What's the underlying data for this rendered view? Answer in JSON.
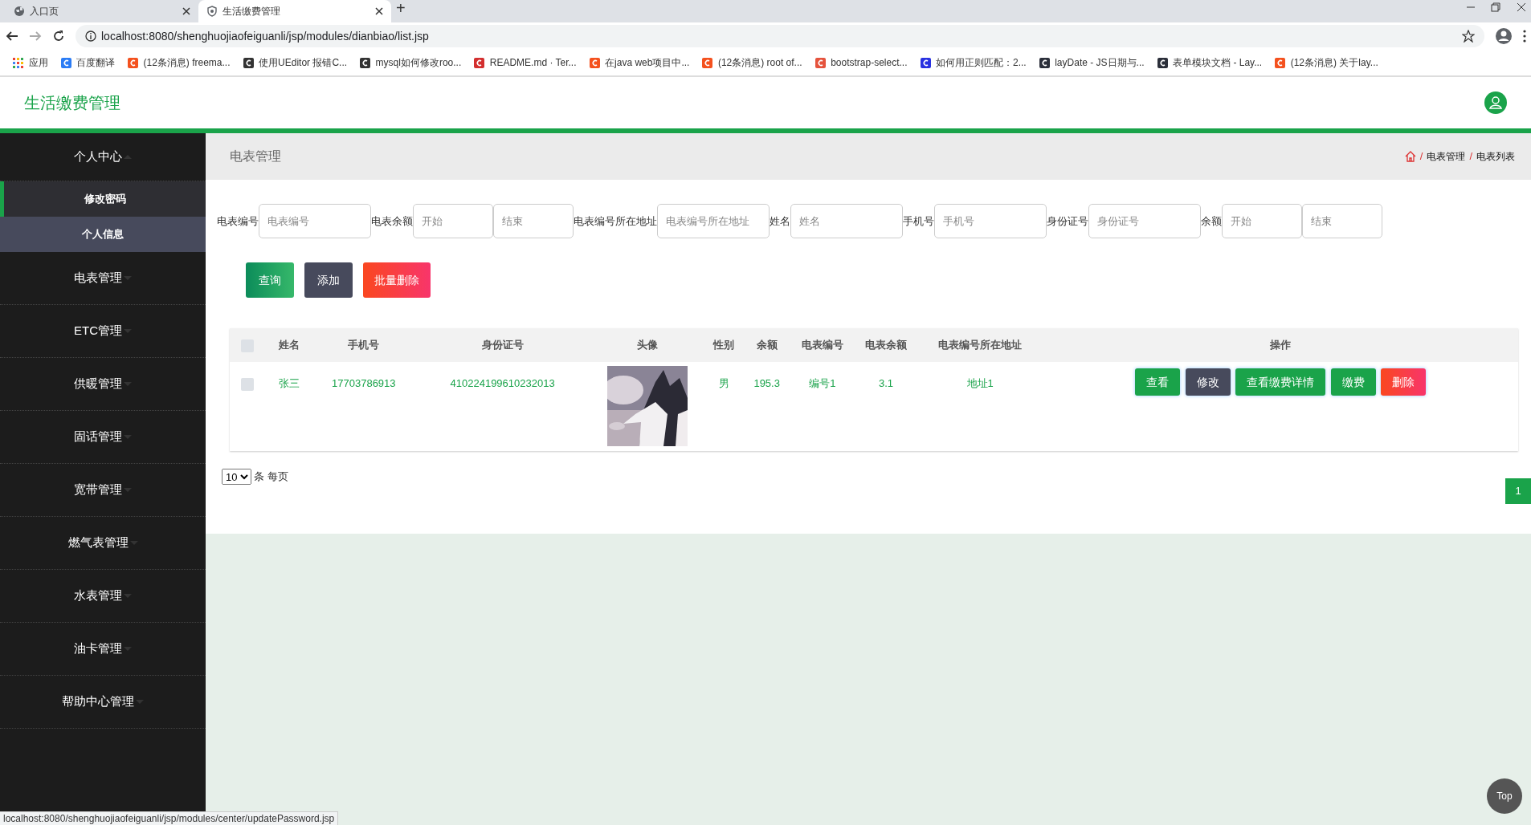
{
  "browser": {
    "tabs": [
      {
        "title": "入口页",
        "selected": false,
        "kind": "globe"
      },
      {
        "title": "生活缴费管理",
        "selected": true,
        "kind": "shield"
      }
    ],
    "new_tab": "+",
    "url": "localhost:8080/shenghuojiaofeiguanli/jsp/modules/dianbiao/list.jsp",
    "bookmarks": [
      {
        "title": "应用"
      },
      {
        "title": "百度翻译",
        "color": "#2b7cf5"
      },
      {
        "title": "(12条消息) freema...",
        "color": "#f4511e"
      },
      {
        "title": "使用UEditor 报错C...",
        "color": "#333333"
      },
      {
        "title": "mysql如何修改roo...",
        "color": "#333333"
      },
      {
        "title": "README.md · Ter...",
        "color": "#d32f2f"
      },
      {
        "title": "在java web项目中...",
        "color": "#f4511e"
      },
      {
        "title": "(12条消息) root of...",
        "color": "#f4511e"
      },
      {
        "title": "bootstrap-select...",
        "color": "#e5533d"
      },
      {
        "title": "如何用正则匹配：2...",
        "color": "#2932e1"
      },
      {
        "title": "layDate - JS日期与...",
        "color": "#2b2f3a"
      },
      {
        "title": "表单模块文档 - Lay...",
        "color": "#2b2f3a"
      },
      {
        "title": "(12条消息) 关于lay...",
        "color": "#f4511e"
      }
    ],
    "status_url": "localhost:8080/shenghuojiaofeiguanli/jsp/modules/center/updatePassword.jsp"
  },
  "app": {
    "title": "生活缴费管理"
  },
  "sidebar": {
    "items": [
      {
        "label": "个人中心",
        "expanded": true,
        "children": [
          {
            "label": "修改密码",
            "selected": true
          },
          {
            "label": "个人信息",
            "selected": false
          }
        ]
      },
      {
        "label": "电表管理",
        "expanded": false
      },
      {
        "label": "ETC管理",
        "expanded": false
      },
      {
        "label": "供暖管理",
        "expanded": false
      },
      {
        "label": "固话管理",
        "expanded": false
      },
      {
        "label": "宽带管理",
        "expanded": false
      },
      {
        "label": "燃气表管理",
        "expanded": false
      },
      {
        "label": "水表管理",
        "expanded": false
      },
      {
        "label": "油卡管理",
        "expanded": false
      },
      {
        "label": "帮助中心管理",
        "expanded": false
      }
    ]
  },
  "page_title": "电表管理",
  "breadcrumb": {
    "separator": "/",
    "items": [
      "电表管理",
      "电表列表"
    ]
  },
  "filters": [
    {
      "label": "电表编号",
      "fields": [
        {
          "placeholder": "电表编号"
        }
      ]
    },
    {
      "label": "电表余额",
      "fields": [
        {
          "placeholder": "开始"
        },
        {
          "placeholder": "结束"
        }
      ]
    },
    {
      "label": "电表编号所在地址",
      "fields": [
        {
          "placeholder": "电表编号所在地址"
        }
      ]
    },
    {
      "label": "姓名",
      "fields": [
        {
          "placeholder": "姓名"
        }
      ]
    },
    {
      "label": "手机号",
      "fields": [
        {
          "placeholder": "手机号"
        }
      ]
    },
    {
      "label": "身份证号",
      "fields": [
        {
          "placeholder": "身份证号"
        }
      ]
    },
    {
      "label": "余额",
      "fields": [
        {
          "placeholder": "开始"
        },
        {
          "placeholder": "结束"
        }
      ]
    }
  ],
  "actions": [
    {
      "label": "查询",
      "kind": "search"
    },
    {
      "label": "添加",
      "kind": "add"
    },
    {
      "label": "批量删除",
      "kind": "delete"
    }
  ],
  "table": {
    "select_all": {
      "checked": false
    },
    "columns": [
      "姓名",
      "手机号",
      "身份证号",
      "头像",
      "性别",
      "余额",
      "电表编号",
      "电表余额",
      "电表编号所在地址",
      "操作"
    ],
    "rows": [
      {
        "checked": false,
        "cells": [
          "张三",
          "17703786913",
          "410224199610232013",
          {
            "kind": "picture"
          },
          "男",
          "195.3",
          "编号1",
          "3.1",
          "地址1"
        ],
        "buttons": [
          {
            "label": "查看",
            "kind": "view"
          },
          {
            "label": "修改",
            "kind": "edit"
          },
          {
            "label": "查看缴费详情",
            "kind": "view"
          },
          {
            "label": "缴费",
            "kind": "view"
          },
          {
            "label": "删除",
            "kind": "delete"
          }
        ]
      }
    ]
  },
  "pager": {
    "page_size": "10",
    "page_size_text": "条 每页",
    "pages": [
      {
        "label": "1",
        "selected": true
      }
    ]
  },
  "top_button": "Top"
}
